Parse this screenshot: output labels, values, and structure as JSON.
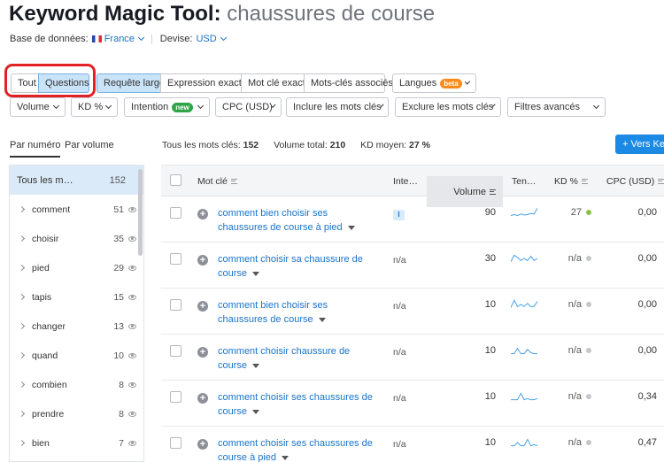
{
  "header": {
    "title": "Keyword Magic Tool:",
    "query": "chaussures de course",
    "database_label": "Base de données:",
    "database_value": "France",
    "currency_label": "Devise:",
    "currency_value": "USD"
  },
  "match_tabs": {
    "all": "Tout",
    "questions": "Questions",
    "broad": "Requête large",
    "phrase": "Expression exacte",
    "exact": "Mot clé exact",
    "related": "Mots-clés associés"
  },
  "languages": {
    "label": "Langues",
    "badge": "beta"
  },
  "filters": {
    "volume": "Volume",
    "kd": "KD %",
    "intent": "Intention",
    "intent_badge": "new",
    "cpc": "CPC (USD)",
    "include": "Inclure les mots clés",
    "exclude": "Exclure les mots clés",
    "advanced": "Filtres avancés"
  },
  "group_tabs": {
    "by_number": "Par numéro",
    "by_volume": "Par volume"
  },
  "summary": {
    "all_keywords_label": "Tous les mots clés:",
    "all_keywords_value": "152",
    "total_volume_label": "Volume total:",
    "total_volume_value": "210",
    "avg_kd_label": "KD moyen:",
    "avg_kd_value": "27 %"
  },
  "export_button": "+ Vers Ke",
  "sidebar": {
    "header": {
      "label": "Tous les m…",
      "count": "152"
    },
    "items": [
      {
        "label": "comment",
        "count": "51"
      },
      {
        "label": "choisir",
        "count": "35"
      },
      {
        "label": "pied",
        "count": "29"
      },
      {
        "label": "tapis",
        "count": "15"
      },
      {
        "label": "changer",
        "count": "13"
      },
      {
        "label": "quand",
        "count": "10"
      },
      {
        "label": "combien",
        "count": "8"
      },
      {
        "label": "prendre",
        "count": "8"
      },
      {
        "label": "bien",
        "count": "7"
      }
    ]
  },
  "table": {
    "columns": {
      "keyword": "Mot clé",
      "intent": "Inte…",
      "volume": "Volume",
      "trend": "Ten…",
      "kd": "KD %",
      "cpc": "CPC (USD)"
    },
    "rows": [
      {
        "keyword_line1": "comment bien choisir ses",
        "keyword_line2": "chaussures de course à pied",
        "intent": "I",
        "volume": "90",
        "trend": [
          0.2,
          0.3,
          0.2,
          0.35,
          0.25,
          0.3,
          0.4,
          0.35,
          0.9
        ],
        "kd": "27",
        "kd_color": "#8bc34a",
        "cpc": "0,00"
      },
      {
        "keyword_line1": "comment choisir sa chaussure de",
        "keyword_line2": "course",
        "intent": "n/a",
        "volume": "30",
        "trend": [
          0.2,
          0.8,
          0.6,
          0.3,
          0.5,
          0.3,
          0.7,
          0.3,
          0.5
        ],
        "kd": "n/a",
        "kd_color": "#c4c6cb",
        "cpc": "0,00"
      },
      {
        "keyword_line1": "comment bien choisir ses",
        "keyword_line2": "chaussures de course",
        "intent": "n/a",
        "volume": "10",
        "trend": [
          0.2,
          0.9,
          0.3,
          0.5,
          0.3,
          0.6,
          0.3,
          0.3,
          0.8
        ],
        "kd": "n/a",
        "kd_color": "#c4c6cb",
        "cpc": "0,00"
      },
      {
        "keyword_line1": "comment choisir chaussure de",
        "keyword_line2": "course",
        "intent": "n/a",
        "volume": "10",
        "trend": [
          0.2,
          0.2,
          0.7,
          0.2,
          0.2,
          0.6,
          0.3,
          0.2,
          0.2
        ],
        "kd": "n/a",
        "kd_color": "#c4c6cb",
        "cpc": "0,00"
      },
      {
        "keyword_line1": "comment choisir ses chaussures de",
        "keyword_line2": "course",
        "intent": "n/a",
        "volume": "10",
        "trend": [
          0.2,
          0.2,
          0.2,
          0.8,
          0.2,
          0.3,
          0.2,
          0.2,
          0.3
        ],
        "kd": "n/a",
        "kd_color": "#c4c6cb",
        "cpc": "0,34"
      },
      {
        "keyword_line1": "comment choisir ses chaussures de",
        "keyword_line2": "course à pied",
        "intent": "n/a",
        "volume": "10",
        "trend": [
          0.2,
          0.2,
          0.5,
          0.2,
          0.2,
          0.8,
          0.2,
          0.3,
          0.2
        ],
        "kd": "n/a",
        "kd_color": "#c4c6cb",
        "cpc": "0,47"
      }
    ]
  }
}
